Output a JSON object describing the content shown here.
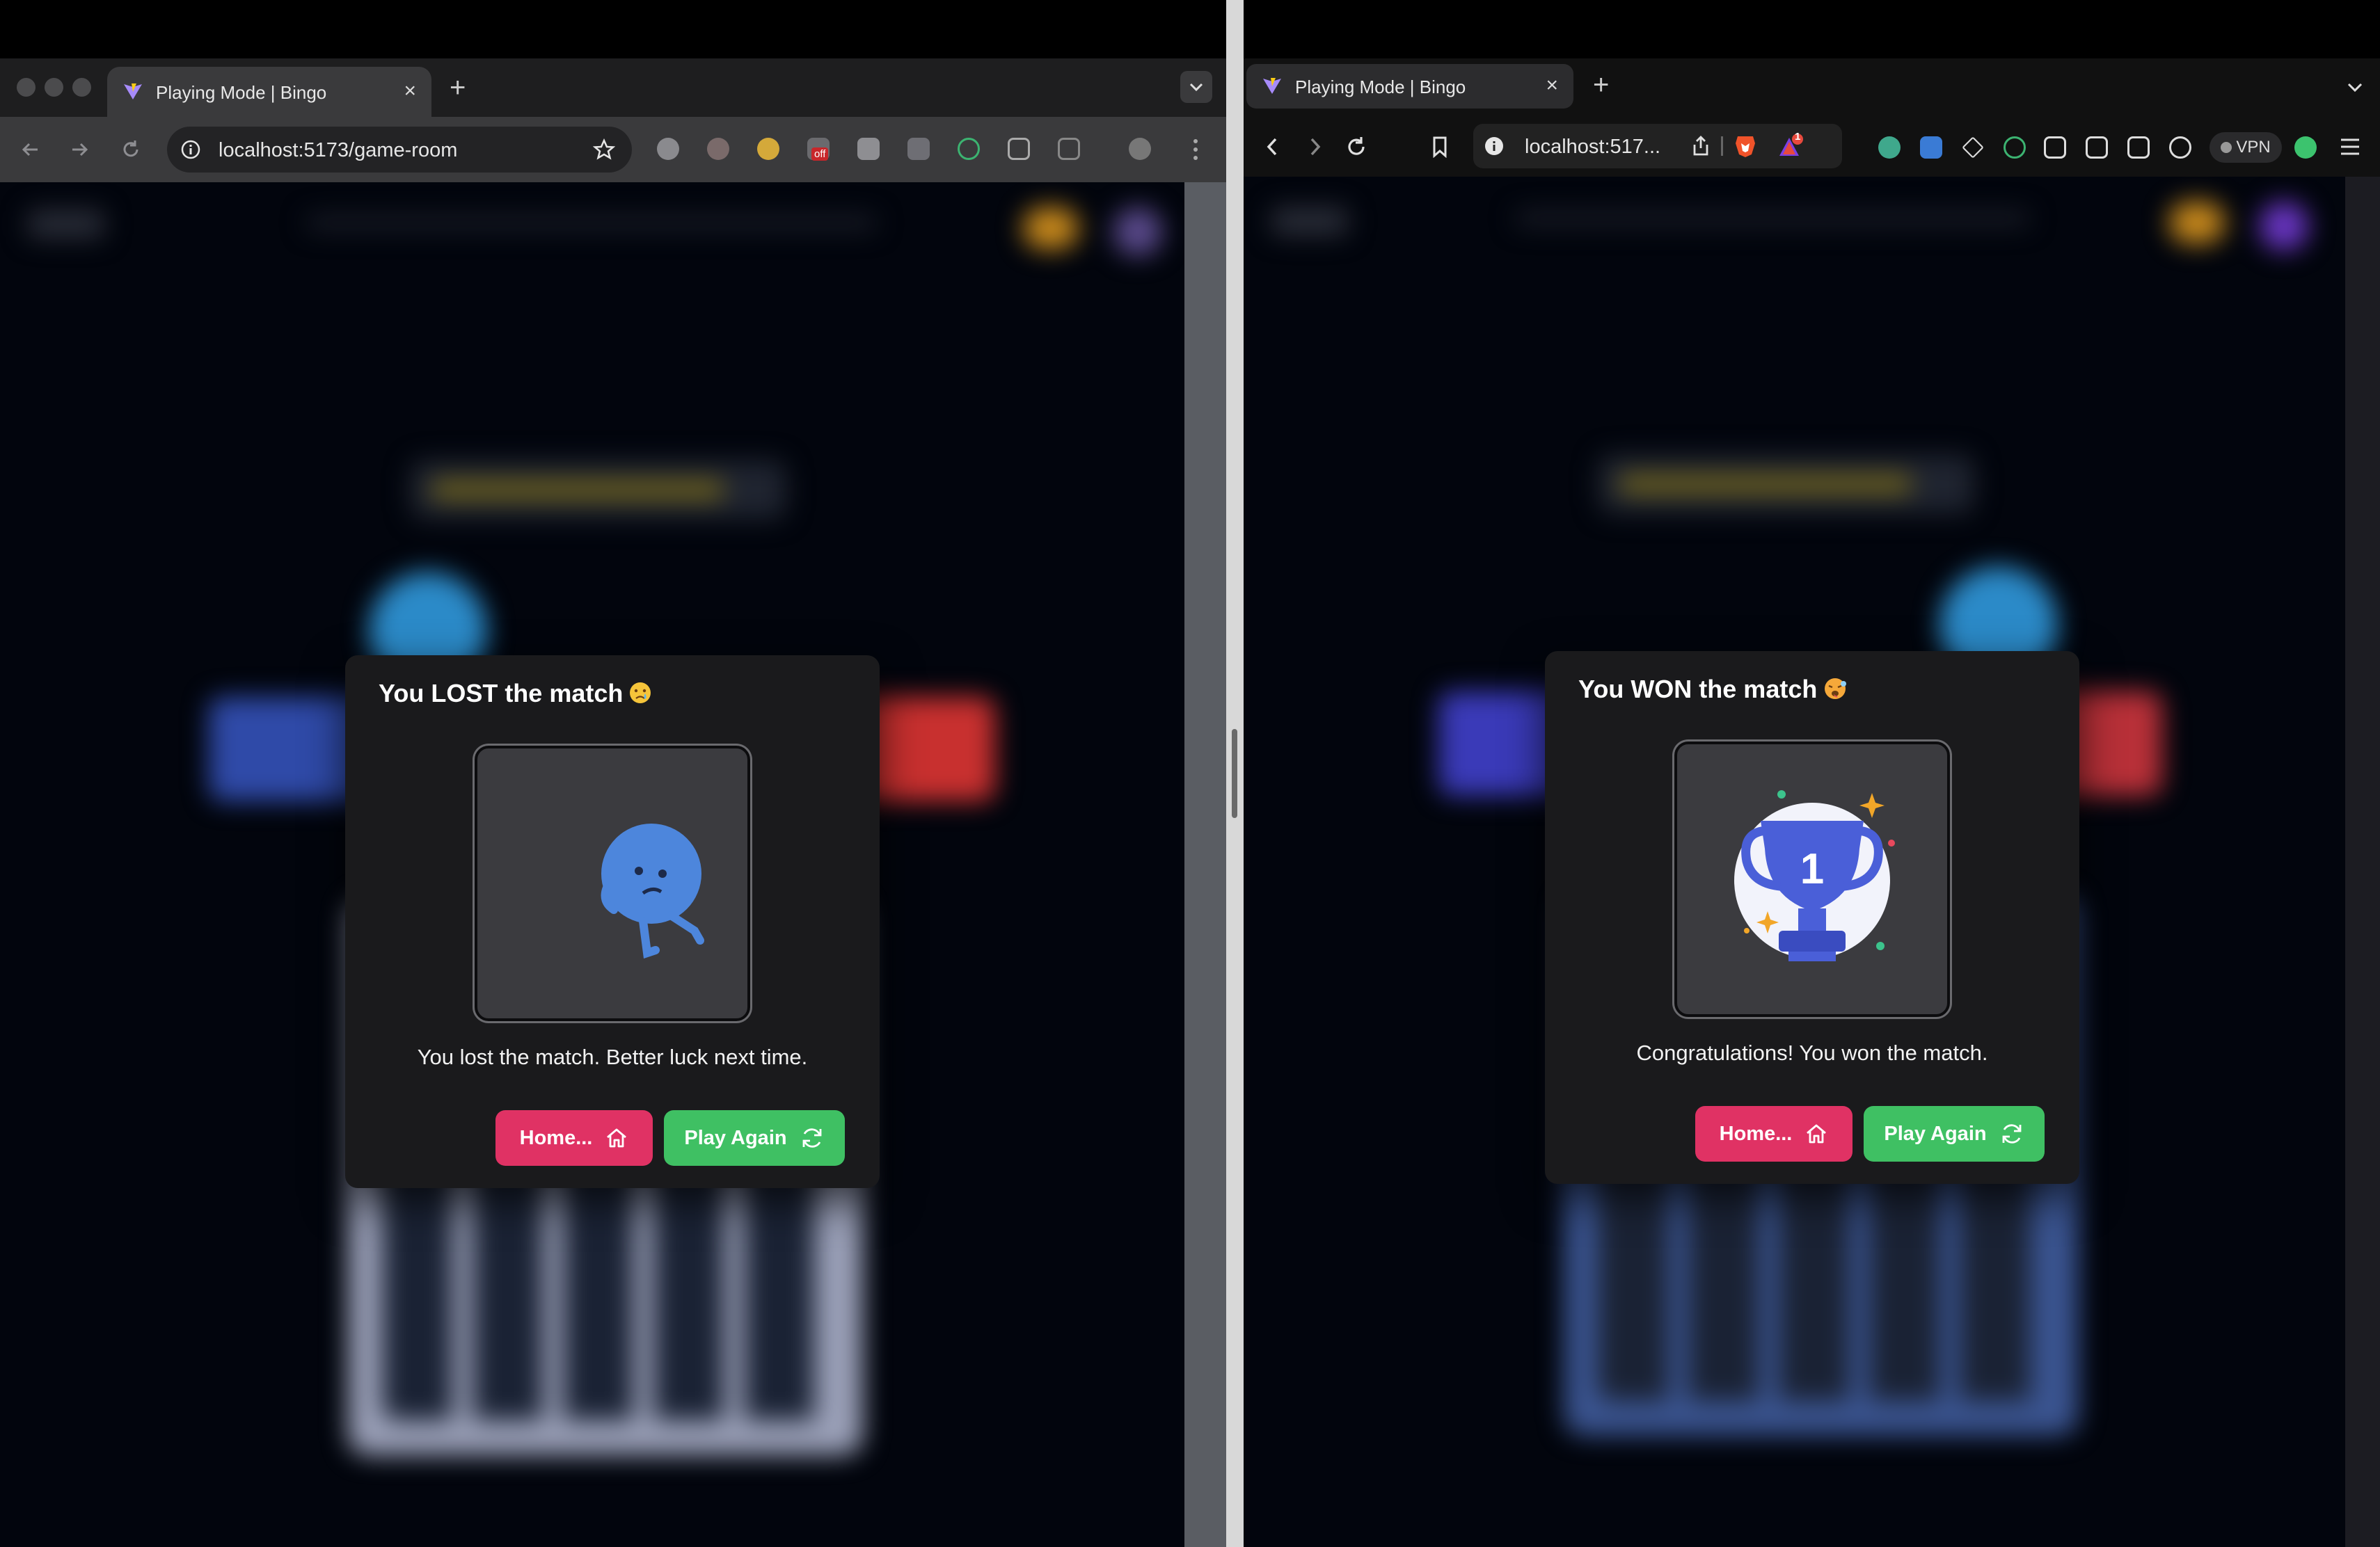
{
  "left_window": {
    "tab": {
      "title": "Playing Mode | Bingo"
    },
    "address": {
      "url": "localhost:5173/game-room"
    },
    "extension_badge": "off",
    "modal": {
      "title": "You LOST the match",
      "message": "You lost the match. Better luck next time.",
      "home_label": "Home...",
      "play_again_label": "Play Again"
    }
  },
  "right_window": {
    "tab": {
      "title": "Playing Mode | Bingo"
    },
    "address": {
      "url": "localhost:517..."
    },
    "notification_count": "1",
    "vpn_label": "VPN",
    "modal": {
      "title": "You WON the match",
      "message": "Congratulations! You won the match.",
      "home_label": "Home...",
      "play_again_label": "Play Again",
      "trophy_number": "1"
    }
  },
  "colors": {
    "home_button": "#e03264",
    "play_again_button": "#3fc063",
    "modal_background": "#1a1a1c",
    "sad_character": "#4d86dc",
    "trophy": "#4a5fd8"
  },
  "icons": [
    "back-arrow-icon",
    "forward-arrow-icon",
    "reload-icon",
    "info-icon",
    "star-icon",
    "bookmark-icon",
    "share-icon",
    "brave-lion-icon",
    "home-icon",
    "refresh-icon",
    "sad-face-emoji-icon",
    "hot-face-emoji-icon",
    "trophy-icon",
    "menu-icon"
  ]
}
